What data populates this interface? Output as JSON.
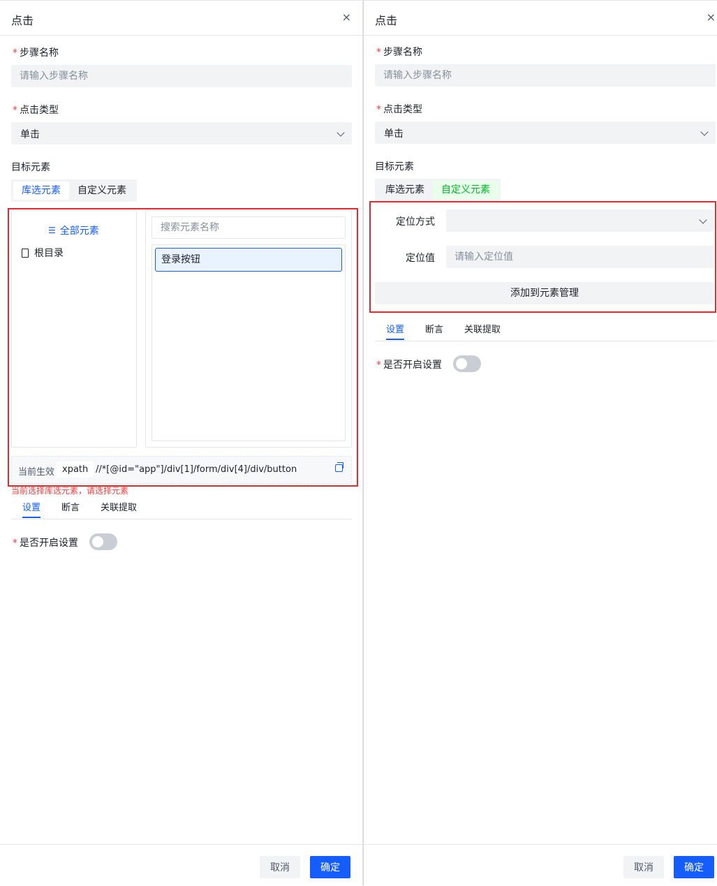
{
  "left": {
    "title": "点击",
    "close": "×",
    "step_name": {
      "label": "步骤名称",
      "placeholder": "请输入步骤名称"
    },
    "click_type": {
      "label": "点击类型",
      "value": "单击"
    },
    "target": {
      "label": "目标元素",
      "tabs": [
        "库选元素",
        "自定义元素"
      ],
      "active_tab": "库选元素"
    },
    "tree": {
      "all_label": "全部元素",
      "root_label": "根目录"
    },
    "search_placeholder": "搜索元素名称",
    "elements": [
      "登录按钮"
    ],
    "effective": {
      "label": "当前生效",
      "type": "xpath",
      "value": "//*[@id=\"app\"]/div[1]/form/div[4]/div/button"
    },
    "error": "当前选择库选元素，请选择元素",
    "bottom_tabs": [
      "设置",
      "断言",
      "关联提取"
    ],
    "enable_label": "是否开启设置",
    "enable_on": false,
    "cancel": "取消",
    "ok": "确定"
  },
  "right": {
    "title": "点击",
    "close": "×",
    "step_name": {
      "label": "步骤名称",
      "placeholder": "请输入步骤名称"
    },
    "click_type": {
      "label": "点击类型",
      "value": "单击"
    },
    "target": {
      "label": "目标元素",
      "tabs": [
        "库选元素",
        "自定义元素"
      ],
      "active_tab": "自定义元素"
    },
    "locate_method": {
      "label": "定位方式",
      "value": ""
    },
    "locate_value": {
      "label": "定位值",
      "placeholder": "请输入定位值"
    },
    "add_button": "添加到元素管理",
    "bottom_tabs": [
      "设置",
      "断言",
      "关联提取"
    ],
    "enable_label": "是否开启设置",
    "enable_on": false,
    "cancel": "取消",
    "ok": "确定"
  },
  "colors": {
    "primary": "#165dff",
    "success": "#00b42a",
    "danger": "#f53f3f",
    "highlight_box": "#e8282b"
  }
}
